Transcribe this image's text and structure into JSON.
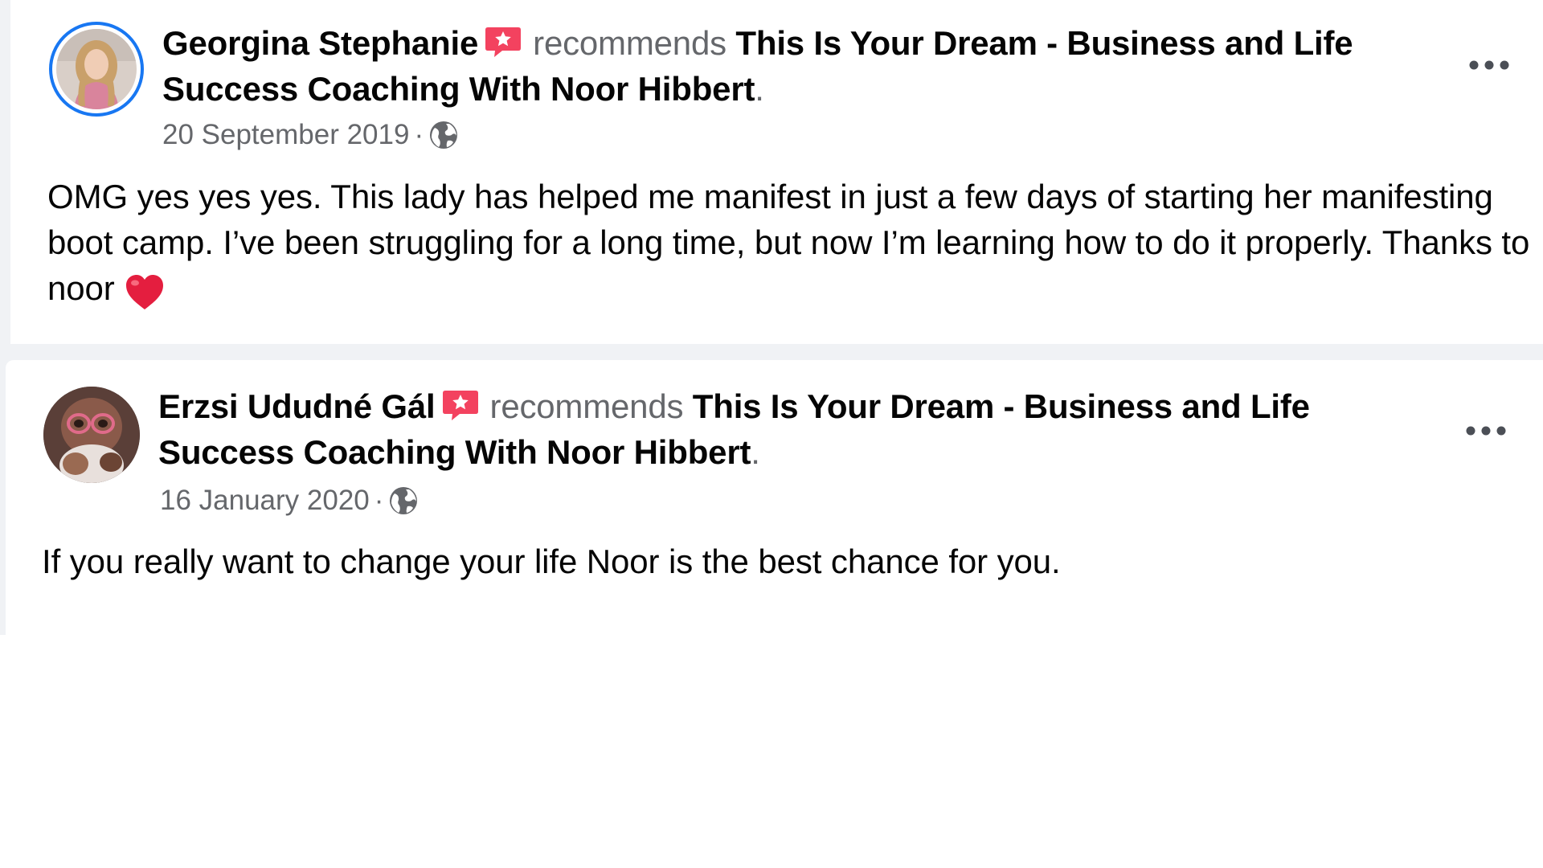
{
  "posts": [
    {
      "author": "Georgina Stephanie",
      "verb": "recommends",
      "page": "This Is Your Dream - Business and Life Success Coaching With Noor Hibbert",
      "period": ".",
      "date": "20 September 2019",
      "separator": "·",
      "audience_icon": "globe-icon",
      "text": "OMG yes yes yes. This lady has helped me manifest in just a few days of starting her manifesting boot camp. I’ve been struggling for a long time, but now I’m learning how to do it properly. Thanks to noor",
      "emoji_icon": "red-heart-icon",
      "menu_icon": "more-options-icon",
      "badge_icon": "recommendation-star-icon"
    },
    {
      "author": "Erzsi Ududné Gál",
      "verb": "recommends",
      "page": "This Is Your Dream - Business and Life Success Coaching With Noor Hibbert",
      "period": ".",
      "date": "16 January 2020",
      "separator": "·",
      "audience_icon": "globe-icon",
      "text": "If you really want to change your life Noor is the best chance for you.",
      "menu_icon": "more-options-icon",
      "badge_icon": "recommendation-star-icon"
    }
  ],
  "colors": {
    "feed_background": "#f0f2f5",
    "card_background": "#ffffff",
    "primary_text": "#050505",
    "secondary_text": "#65676b",
    "story_ring": "#1877f2",
    "badge_red": "#f3425f",
    "heart_red": "#e41e3f"
  }
}
